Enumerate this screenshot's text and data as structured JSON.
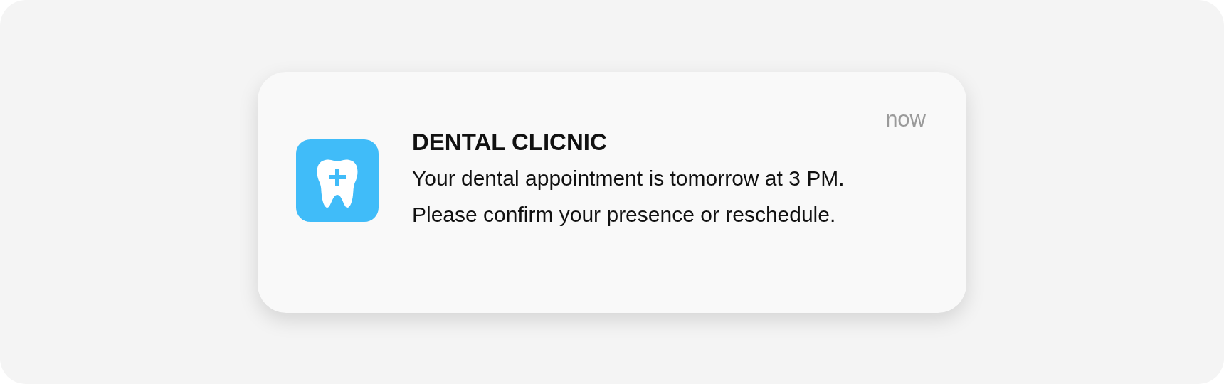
{
  "notification": {
    "app_name": "DENTAL CLICNIC",
    "time": "now",
    "message": "Your dental appointment is tomorrow at 3 PM. Please confirm your presence or reschedule."
  }
}
